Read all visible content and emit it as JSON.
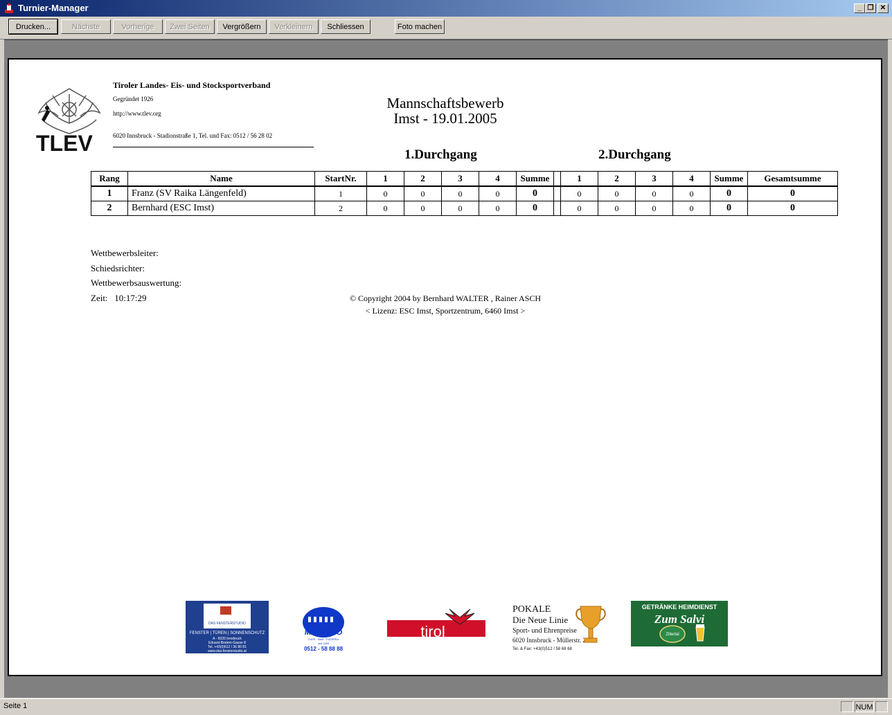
{
  "window": {
    "title": "Turnier-Manager",
    "minimize": "_",
    "restore": "❐",
    "close": "✕"
  },
  "toolbar": {
    "print": "Drucken...",
    "next": "Nächste",
    "previous": "Vorherige",
    "two_pages": "Zwei Seiten",
    "zoom_in": "Vergrößern",
    "zoom_out": "Verkleinern",
    "close": "Schliessen",
    "snapshot": "Foto machen"
  },
  "report": {
    "org": {
      "name": "Tiroler Landes- Eis- und Stocksportverband",
      "founded": "Gegründet 1926",
      "url": "http://www.tlev.org",
      "address": "6020 Innsbruck - Stadionstraße 1, Tel. und Fax: 0512 / 56 28 02",
      "logo_text": "TLEV"
    },
    "title_line1": "Mannschaftsbewerb",
    "title_line2": "Imst - 19.01.2005",
    "round1": "1.Durchgang",
    "round2": "2.Durchgang",
    "table": {
      "headers": [
        "Rang",
        "Name",
        "StartNr.",
        "1",
        "2",
        "3",
        "4",
        "Summe",
        "1",
        "2",
        "3",
        "4",
        "Summe",
        "Gesamtsumme"
      ],
      "rows": [
        {
          "rang": "1",
          "name": "Franz (SV Raika Längenfeld)",
          "startnr": "1",
          "r1": [
            "0",
            "0",
            "0",
            "0"
          ],
          "sum1": "0",
          "r2": [
            "0",
            "0",
            "0",
            "0"
          ],
          "sum2": "0",
          "total": "0"
        },
        {
          "rang": "2",
          "name": "Bernhard (ESC Imst)",
          "startnr": "2",
          "r1": [
            "0",
            "0",
            "0",
            "0"
          ],
          "sum1": "0",
          "r2": [
            "0",
            "0",
            "0",
            "0"
          ],
          "sum2": "0",
          "total": "0"
        }
      ]
    },
    "leader_label": "Wettbewerbsleiter:",
    "referee_label": "Schiedsrichter:",
    "evaluation_label": "Wettbewerbsauswertung:",
    "time_label": "Zeit:",
    "time_value": "10:17:29",
    "copyright": "© Copyright 2004 by Bernhard WALTER , Rainer ASCH",
    "license": "< Lizenz: ESC Imst, Sportzentrum, 6460 Imst >",
    "sponsors": {
      "s1": {
        "line1": "FENSTER | TÜREN | SONNENSCHUTZ",
        "line2": "A - 6020 Innsbruck",
        "line3": "Eduard-Bodem-Gasse 8",
        "line4": "Tel. +43(0)512 / 36 80 81",
        "line5": "www.das-fensterstudio.at",
        "badge": "DAS FENSTERSTUDIO"
      },
      "s2": {
        "name": "MAURIZIO",
        "sub": "CAFE · BAR · PIZZERIA",
        "since": "seit 1999",
        "phone": "0512 - 58 88 88"
      },
      "s3": {
        "name": "tirol"
      },
      "s4": {
        "line1": "POKALE",
        "line2": "Die Neue Linie",
        "line3": "Sport- und Ehrenpreise",
        "line4": "6020 Innsbruck - Müllerstr. 20",
        "line5": "Tel. & Fax: +43(0)512 / 58 68 68"
      },
      "s5": {
        "line1": "GETRÄNKE HEIMDIENST",
        "line2": "Zum Salvi",
        "line3": "Zillertal"
      }
    }
  },
  "status": {
    "page": "Seite 1",
    "num": "NUM"
  }
}
